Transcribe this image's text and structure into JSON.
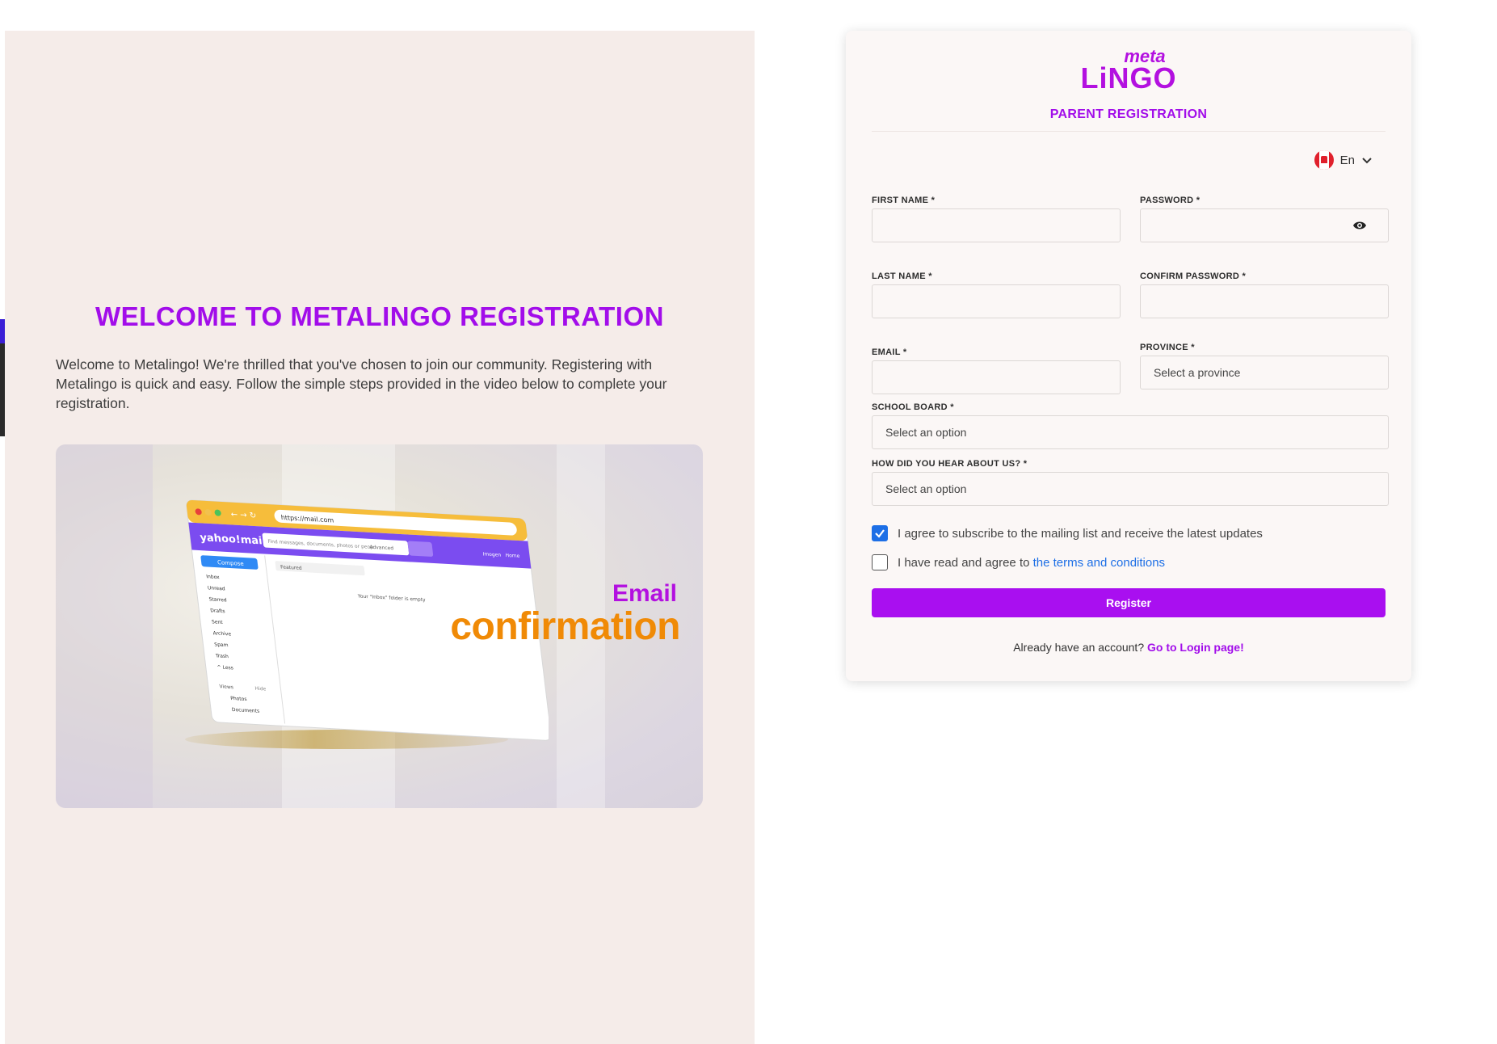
{
  "left": {
    "title": "WELCOME TO METALINGO REGISTRATION",
    "intro": "Welcome to Metalingo! We're thrilled that you've chosen to join our community. Registering with Metalingo is quick and easy. Follow the simple steps provided in the video below to complete your registration.",
    "video": {
      "browser_url": "https://mail.com",
      "brand": "yahoo!mail",
      "search_placeholder": "Find messages, documents, photos or peop",
      "search_option": "Advanced",
      "compose": "Compose",
      "folders": [
        "Inbox",
        "Unread",
        "Starred",
        "Drafts",
        "Sent",
        "Archive",
        "Spam",
        "Trash",
        "^ Less"
      ],
      "views_label": "Views",
      "hide_label": "Hide",
      "views": [
        "Photos",
        "Documents"
      ],
      "filter": "Featured",
      "empty_message": "Your \"Inbox\" folder is empty",
      "user": "Imogen",
      "home": "Home",
      "caption_line1": "Email",
      "caption_line2": "confirmation"
    }
  },
  "card": {
    "logo_top": "meta",
    "logo_main": "LiNGO",
    "title": "PARENT REGISTRATION",
    "language": "En",
    "fields": {
      "first_name_label": "FIRST NAME *",
      "password_label": "PASSWORD *",
      "last_name_label": "LAST NAME *",
      "confirm_password_label": "CONFIRM PASSWORD *",
      "email_label": "EMAIL *",
      "province_label": "PROVINCE *",
      "province_placeholder": "Select a province",
      "school_board_label": "SCHOOL BOARD *",
      "school_board_placeholder": "Select an option",
      "hear_label": "HOW DID YOU HEAR ABOUT US? *",
      "hear_placeholder": "Select an option"
    },
    "subscribe_text": "I agree to subscribe to the mailing list and receive the latest updates",
    "subscribe_checked": true,
    "terms_prefix": "I have read and agree to ",
    "terms_link": "the terms and conditions",
    "terms_checked": false,
    "register_label": "Register",
    "login_prompt": "Already have an account?",
    "login_link": "Go to Login page!"
  },
  "colors": {
    "brand_purple": "#a20dea",
    "accent_orange": "#f08a06",
    "link_blue": "#1d6fe6"
  }
}
